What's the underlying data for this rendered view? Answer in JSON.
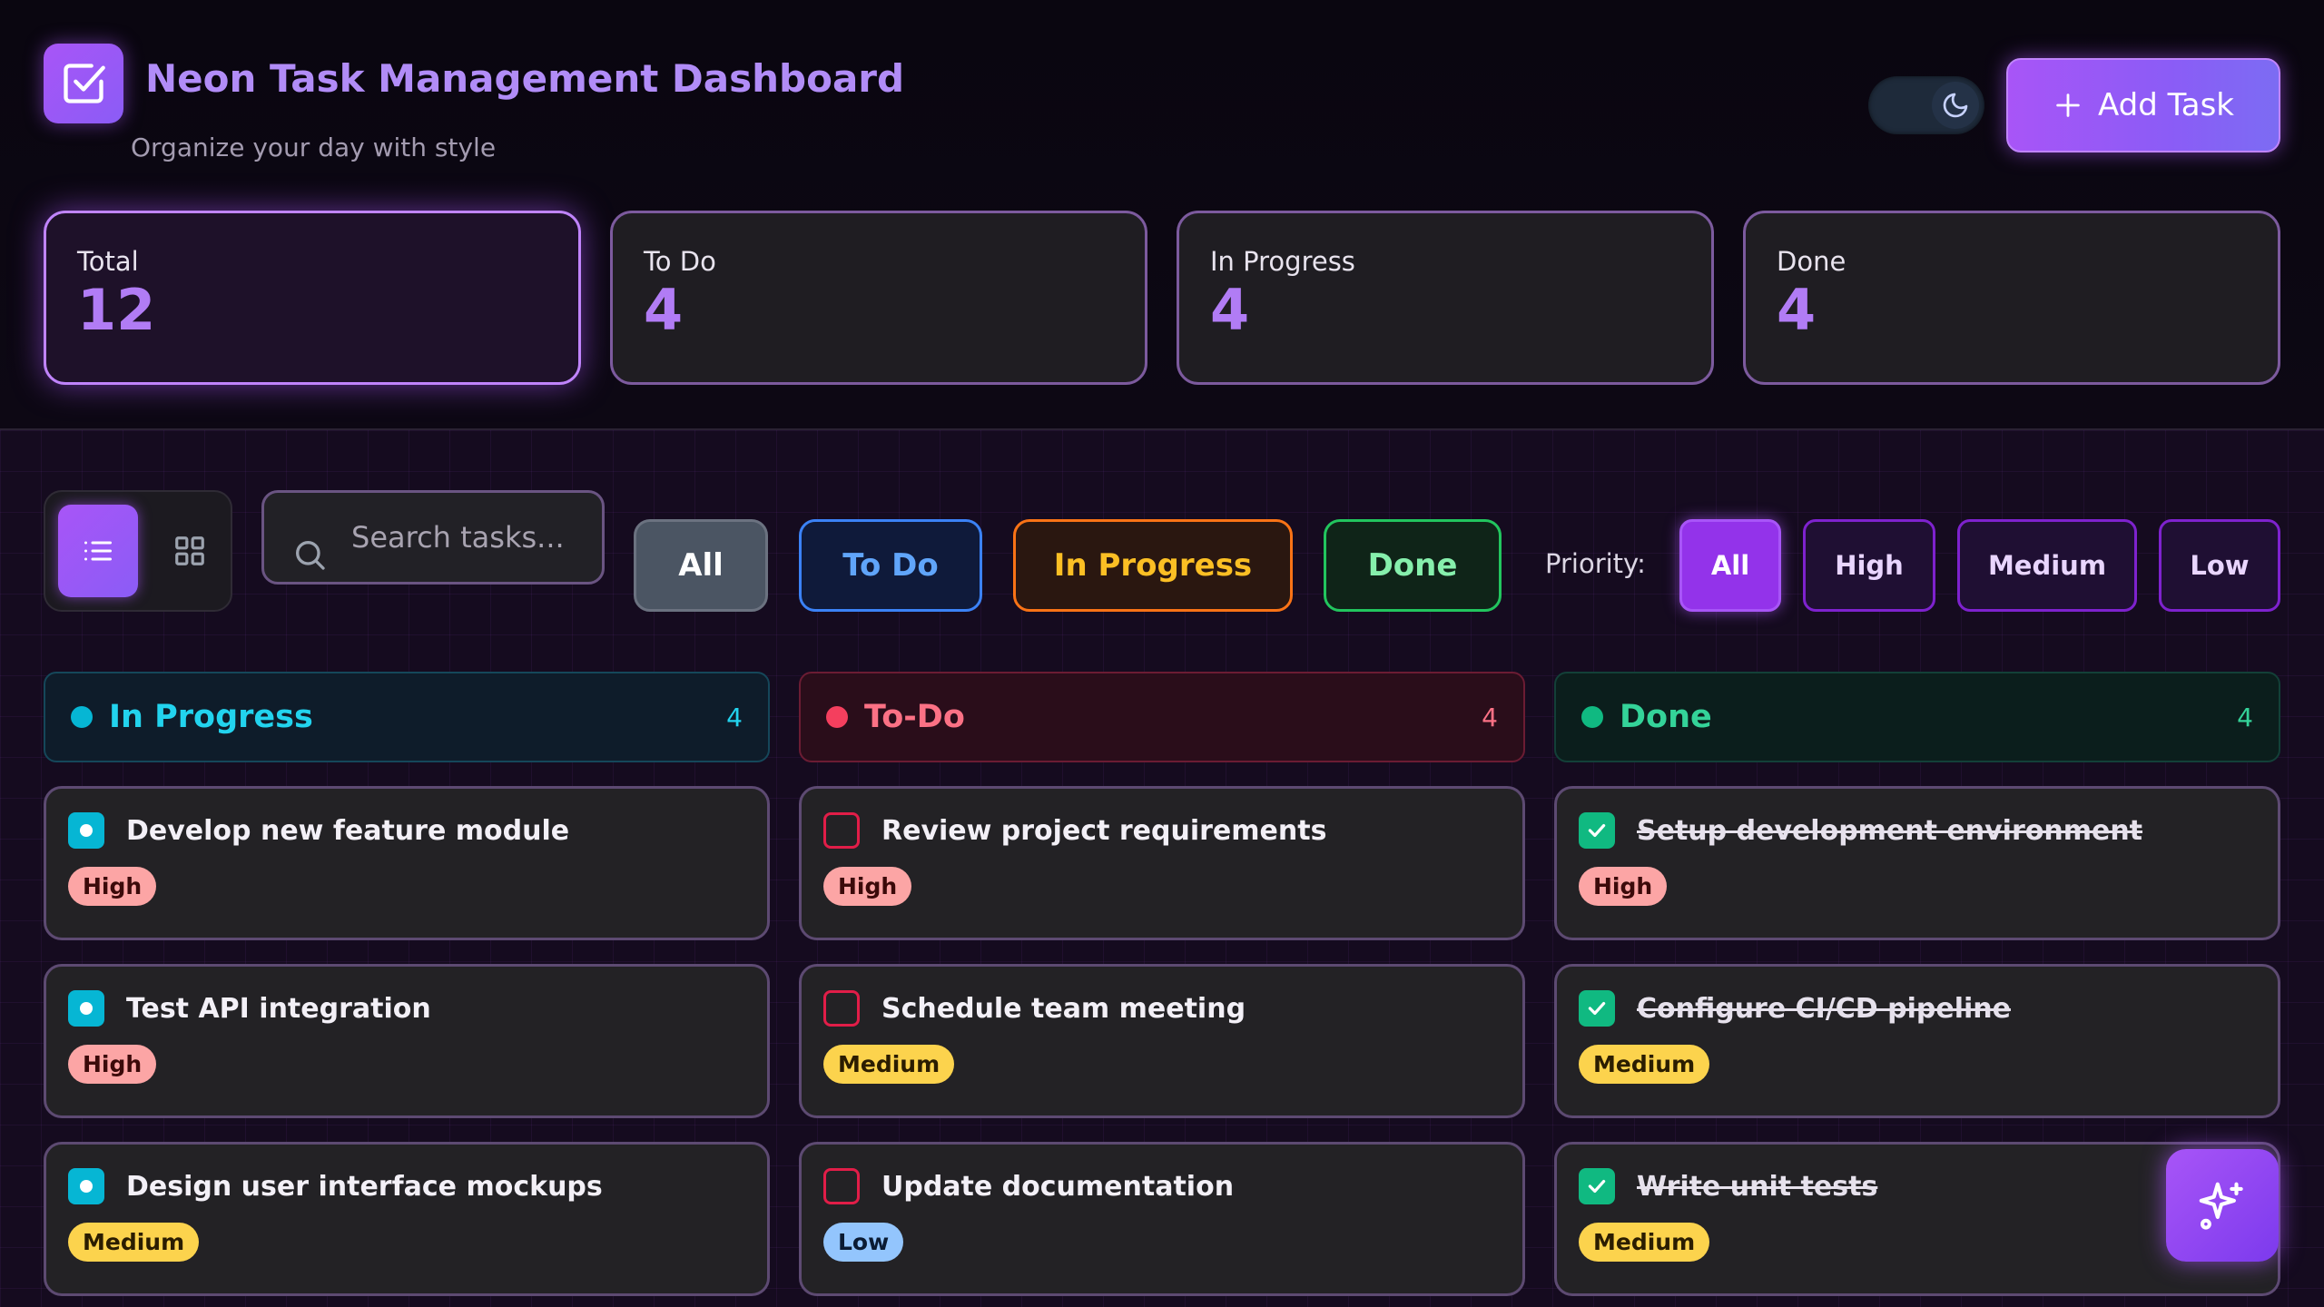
{
  "app": {
    "title": "Neon Task Management Dashboard",
    "subtitle": "Organize your day with style",
    "logo_icon": "checkbox-icon"
  },
  "header": {
    "theme_toggle_icon": "moon-icon",
    "add_task_label": "Add Task"
  },
  "stats": [
    {
      "label": "Total",
      "value": "12"
    },
    {
      "label": "To Do",
      "value": "4"
    },
    {
      "label": "In Progress",
      "value": "4"
    },
    {
      "label": "Done",
      "value": "4"
    }
  ],
  "toolbar": {
    "view_list_icon": "list-icon",
    "view_grid_icon": "grid-icon",
    "search_placeholder": "Search tasks...",
    "search_value": "",
    "status_filters": [
      "All",
      "To Do",
      "In Progress",
      "Done"
    ],
    "priority_label": "Priority:",
    "priority_filters": [
      "All",
      "High",
      "Medium",
      "Low"
    ]
  },
  "columns": [
    {
      "title": "In Progress",
      "count": "4",
      "color": "#06b6d4",
      "tasks": [
        {
          "title": "Develop new feature module",
          "priority": "High"
        },
        {
          "title": "Test API integration",
          "priority": "High"
        },
        {
          "title": "Design user interface mockups",
          "priority": "Medium"
        }
      ]
    },
    {
      "title": "To-Do",
      "count": "4",
      "color": "#f43f5e",
      "tasks": [
        {
          "title": "Review project requirements",
          "priority": "High"
        },
        {
          "title": "Schedule team meeting",
          "priority": "Medium"
        },
        {
          "title": "Update documentation",
          "priority": "Low"
        }
      ]
    },
    {
      "title": "Done",
      "count": "4",
      "color": "#10b981",
      "tasks": [
        {
          "title": "Setup development environment",
          "priority": "High"
        },
        {
          "title": "Configure CI/CD pipeline",
          "priority": "Medium"
        },
        {
          "title": "Write unit tests",
          "priority": "Medium"
        }
      ]
    }
  ],
  "fab_icon": "sparkles-icon",
  "colors": {
    "accent": "#a855f7",
    "todo": "#3b82f6",
    "progress": "#f97316",
    "done": "#22c55e"
  }
}
